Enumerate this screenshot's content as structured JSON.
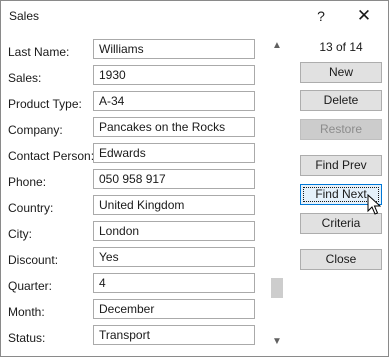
{
  "window": {
    "title": "Sales",
    "help_label": "?",
    "close_label": "✕"
  },
  "fields": [
    {
      "label": "Last Name:",
      "value": "Williams"
    },
    {
      "label": "Sales:",
      "value": "1930"
    },
    {
      "label": "Product Type:",
      "value": "A-34"
    },
    {
      "label": "Company:",
      "value": "Pancakes on the Rocks"
    },
    {
      "label": "Contact Person:",
      "value": "Edwards"
    },
    {
      "label": "Phone:",
      "value": "050 958 917"
    },
    {
      "label": "Country:",
      "value": "United Kingdom"
    },
    {
      "label": "City:",
      "value": "London"
    },
    {
      "label": "Discount:",
      "value": "Yes"
    },
    {
      "label": "Quarter:",
      "value": "4"
    },
    {
      "label": "Month:",
      "value": "December"
    },
    {
      "label": "Status:",
      "value": "Transport"
    }
  ],
  "record_counter": "13 of 14",
  "buttons": {
    "new": "New",
    "delete": "Delete",
    "restore": "Restore",
    "find_prev": "Find Prev",
    "find_next": "Find Next",
    "criteria": "Criteria",
    "close": "Close"
  },
  "scrollbar": {
    "up_arrow": "▲",
    "down_arrow": "▼",
    "position_fraction": 0.92
  },
  "colors": {
    "focus_border": "#0078d7",
    "button_bg": "#e1e1e1",
    "disabled_text": "#8c8c8c"
  }
}
